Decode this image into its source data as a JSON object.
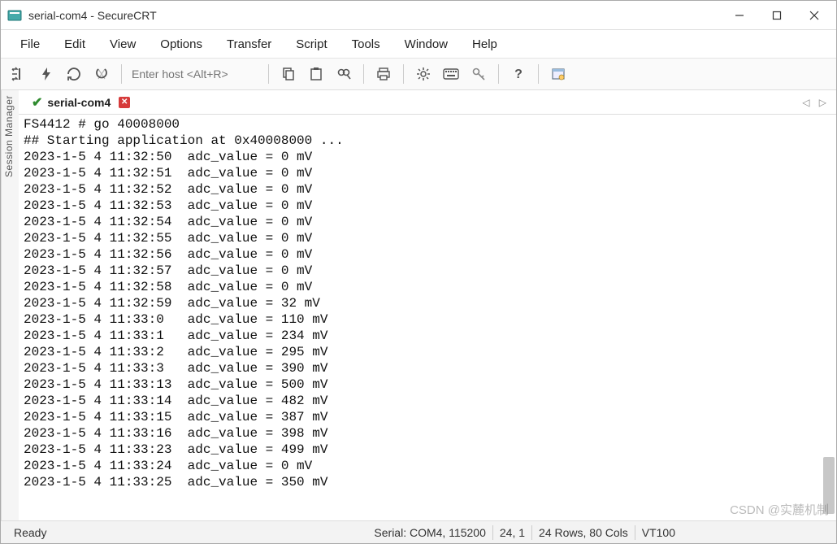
{
  "window": {
    "title": "serial-com4 - SecureCRT"
  },
  "menu": {
    "items": [
      "File",
      "Edit",
      "View",
      "Options",
      "Transfer",
      "Script",
      "Tools",
      "Window",
      "Help"
    ]
  },
  "toolbar": {
    "host_placeholder": "Enter host <Alt+R>"
  },
  "sidebar": {
    "label": "Session Manager"
  },
  "tab": {
    "label": "serial-com4"
  },
  "terminal": {
    "header1": "FS4412 # go 40008000",
    "header2": "## Starting application at 0x40008000 ...",
    "rows": [
      {
        "ts": "2023-1-5 4 11:32:50",
        "label": "adc_value",
        "val": 0,
        "unit": "mV"
      },
      {
        "ts": "2023-1-5 4 11:32:51",
        "label": "adc_value",
        "val": 0,
        "unit": "mV"
      },
      {
        "ts": "2023-1-5 4 11:32:52",
        "label": "adc_value",
        "val": 0,
        "unit": "mV"
      },
      {
        "ts": "2023-1-5 4 11:32:53",
        "label": "adc_value",
        "val": 0,
        "unit": "mV"
      },
      {
        "ts": "2023-1-5 4 11:32:54",
        "label": "adc_value",
        "val": 0,
        "unit": "mV"
      },
      {
        "ts": "2023-1-5 4 11:32:55",
        "label": "adc_value",
        "val": 0,
        "unit": "mV"
      },
      {
        "ts": "2023-1-5 4 11:32:56",
        "label": "adc_value",
        "val": 0,
        "unit": "mV"
      },
      {
        "ts": "2023-1-5 4 11:32:57",
        "label": "adc_value",
        "val": 0,
        "unit": "mV"
      },
      {
        "ts": "2023-1-5 4 11:32:58",
        "label": "adc_value",
        "val": 0,
        "unit": "mV"
      },
      {
        "ts": "2023-1-5 4 11:32:59",
        "label": "adc_value",
        "val": 32,
        "unit": "mV"
      },
      {
        "ts": "2023-1-5 4 11:33:0",
        "label": "adc_value",
        "val": 110,
        "unit": "mV"
      },
      {
        "ts": "2023-1-5 4 11:33:1",
        "label": "adc_value",
        "val": 234,
        "unit": "mV"
      },
      {
        "ts": "2023-1-5 4 11:33:2",
        "label": "adc_value",
        "val": 295,
        "unit": "mV"
      },
      {
        "ts": "2023-1-5 4 11:33:3",
        "label": "adc_value",
        "val": 390,
        "unit": "mV"
      },
      {
        "ts": "2023-1-5 4 11:33:13",
        "label": "adc_value",
        "val": 500,
        "unit": "mV"
      },
      {
        "ts": "2023-1-5 4 11:33:14",
        "label": "adc_value",
        "val": 482,
        "unit": "mV"
      },
      {
        "ts": "2023-1-5 4 11:33:15",
        "label": "adc_value",
        "val": 387,
        "unit": "mV"
      },
      {
        "ts": "2023-1-5 4 11:33:16",
        "label": "adc_value",
        "val": 398,
        "unit": "mV"
      },
      {
        "ts": "2023-1-5 4 11:33:23",
        "label": "adc_value",
        "val": 499,
        "unit": "mV"
      },
      {
        "ts": "2023-1-5 4 11:33:24",
        "label": "adc_value",
        "val": 0,
        "unit": "mV"
      },
      {
        "ts": "2023-1-5 4 11:33:25",
        "label": "adc_value",
        "val": 350,
        "unit": "mV"
      }
    ]
  },
  "status": {
    "ready": "Ready",
    "serial": "Serial: COM4, 115200",
    "cursor": "24,   1",
    "size": "24 Rows, 80 Cols",
    "term": "VT100"
  },
  "watermark": "CSDN @实麓机制"
}
